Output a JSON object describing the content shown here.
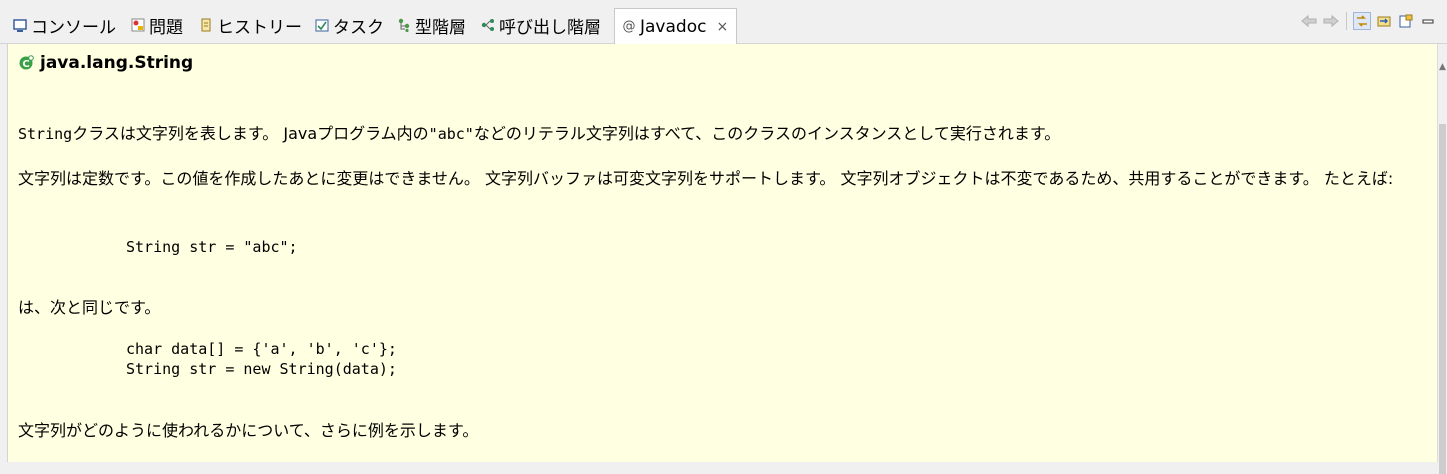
{
  "tabs": [
    {
      "label": "コンソール",
      "icon": "console-icon"
    },
    {
      "label": "問題",
      "icon": "problems-icon"
    },
    {
      "label": "ヒストリー",
      "icon": "history-icon"
    },
    {
      "label": "タスク",
      "icon": "tasks-icon"
    },
    {
      "label": "型階層",
      "icon": "type-hierarchy-icon"
    },
    {
      "label": "呼び出し階層",
      "icon": "call-hierarchy-icon"
    },
    {
      "label": "Javadoc",
      "icon": "javadoc-at-icon",
      "active": true,
      "close": "×"
    }
  ],
  "toolbar": [
    "back-icon",
    "forward-icon",
    "link-with-selection-icon",
    "open-declaration-icon",
    "open-external-icon",
    "minimize-icon"
  ],
  "doc": {
    "title": "java.lang.String",
    "p1_code": "String",
    "p1_a": "クラスは文字列を表します。 Javaプログラム内の",
    "p1_code2": "\"abc\"",
    "p1_b": "などのリテラル文字列はすべて、このクラスのインスタンスとして実行されます。",
    "p2": "文字列は定数です。この値を作成したあとに変更はできません。 文字列バッファは可変文字列をサポートします。 文字列オブジェクトは不変であるため、共用することができます。 たとえば:",
    "code1": "String str = \"abc\";",
    "p3": "は、次と同じです。",
    "code2_line1": "char data[] = {'a', 'b', 'c'};",
    "code2_line2": "String str = new String(data);",
    "p4": "文字列がどのように使われるかについて、さらに例を示します。"
  }
}
